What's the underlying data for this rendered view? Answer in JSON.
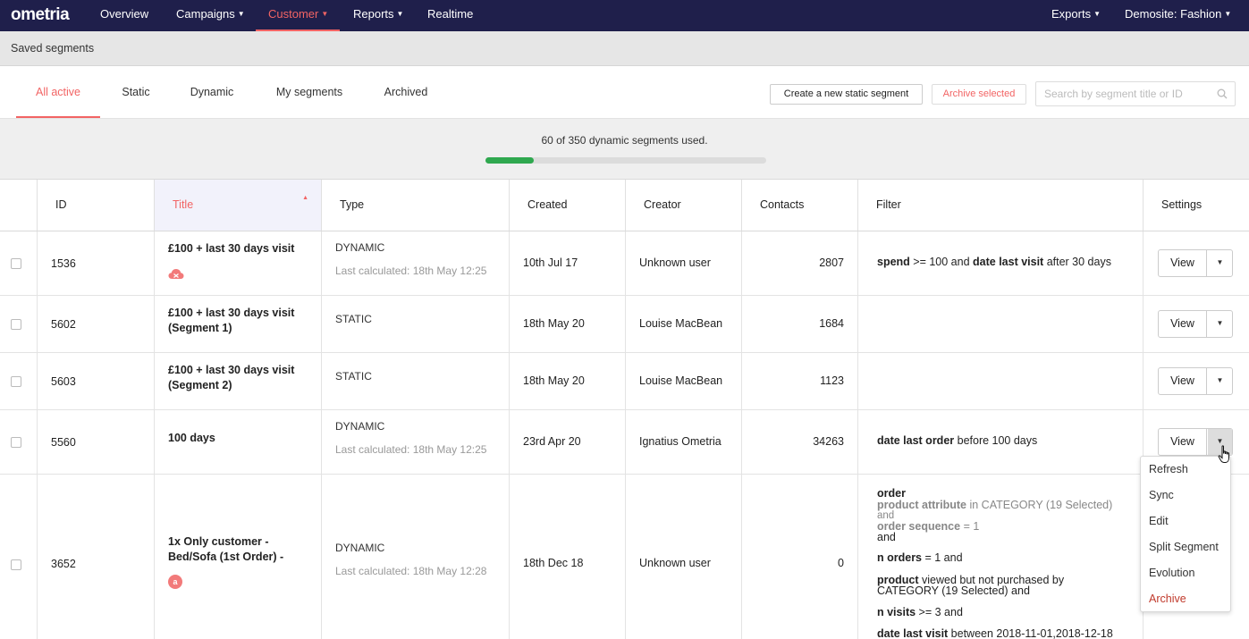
{
  "brand": {
    "logo": "ometria",
    "accent": "#f26464",
    "nav_bg": "#1f1f4b",
    "progress_color": "#2fa84f"
  },
  "nav": {
    "items": [
      {
        "label": "Overview",
        "has_caret": false,
        "active": false
      },
      {
        "label": "Campaigns",
        "has_caret": true,
        "active": false
      },
      {
        "label": "Customer",
        "has_caret": true,
        "active": true
      },
      {
        "label": "Reports",
        "has_caret": true,
        "active": false
      },
      {
        "label": "Realtime",
        "has_caret": false,
        "active": false
      }
    ],
    "right_items": [
      {
        "label": "Exports",
        "has_caret": true
      },
      {
        "label": "Demosite: Fashion",
        "has_caret": true
      }
    ]
  },
  "breadcrumb": "Saved segments",
  "tabs": [
    {
      "label": "All active",
      "active": true
    },
    {
      "label": "Static",
      "active": false
    },
    {
      "label": "Dynamic",
      "active": false
    },
    {
      "label": "My segments",
      "active": false
    },
    {
      "label": "Archived",
      "active": false
    }
  ],
  "actions": {
    "create_label": "Create a new static segment",
    "archive_label": "Archive selected",
    "search_placeholder": "Search by segment title or ID"
  },
  "usage": {
    "text": "60 of 350 dynamic segments used.",
    "used": 60,
    "total": 350
  },
  "columns": [
    "ID",
    "Title",
    "Type",
    "Created",
    "Creator",
    "Contacts",
    "Filter",
    "Settings"
  ],
  "sorted_column": "Title",
  "rows": [
    {
      "id": "1536",
      "title": "£100 + last 30 days visit",
      "type": "DYNAMIC",
      "last_calculated": "Last calculated: 18th May 12:25",
      "created": "10th Jul 17",
      "creator": "Unknown user",
      "contacts": "2807",
      "filter_parts": [
        {
          "b": "spend",
          "t": " >= 100  and  "
        },
        {
          "b": "date last visit",
          "t": " after 30 days"
        }
      ],
      "badge": "cloud-icon"
    },
    {
      "id": "5602",
      "title": "£100 + last 30 days visit (Segment 1)",
      "type": "STATIC",
      "last_calculated": "",
      "created": "18th May 20",
      "creator": "Louise MacBean",
      "contacts": "1684",
      "filter_parts": []
    },
    {
      "id": "5603",
      "title": "£100 + last 30 days visit (Segment 2)",
      "type": "STATIC",
      "last_calculated": "",
      "created": "18th May 20",
      "creator": "Louise MacBean",
      "contacts": "1123",
      "filter_parts": []
    },
    {
      "id": "5560",
      "title": "100 days",
      "type": "DYNAMIC",
      "last_calculated": "Last calculated: 18th May 12:25",
      "created": "23rd Apr 20",
      "creator": "Ignatius Ometria",
      "contacts": "34263",
      "filter_parts": [
        {
          "b": "date last order",
          "t": " before 100 days"
        }
      ]
    },
    {
      "id": "3652",
      "title": "1x Only customer - Bed/Sofa (1st Order) -",
      "type": "DYNAMIC",
      "last_calculated": "Last calculated: 18th May 12:28",
      "created": "18th Dec 18",
      "creator": "Unknown user",
      "contacts": "0",
      "badge": "a-badge-icon",
      "badge_text": "a",
      "filter_lines": [
        {
          "b": "order",
          "t": ""
        },
        {
          "b": "product attribute",
          "t": " in CATEGORY (19 Selected)",
          "grey": true
        },
        {
          "b": "",
          "t": "   and",
          "grey": true
        },
        {
          "b": "order sequence",
          "t": " = 1",
          "grey": true
        },
        {
          "b": "",
          "t": "  and"
        },
        {
          "b": "n orders",
          "t": " = 1  and"
        },
        {
          "b": "product",
          "t": " viewed but not purchased by"
        },
        {
          "b": "",
          "t": "CATEGORY (19 Selected)  and"
        },
        {
          "b": "n visits",
          "t": " >= 3  and"
        },
        {
          "b": "date last visit",
          "t": " between 2018-11-01,2018-12-18"
        }
      ]
    }
  ],
  "view_label": "View",
  "settings_menu": {
    "items": [
      "Refresh",
      "Sync",
      "Edit",
      "Split Segment",
      "Evolution",
      "Archive"
    ]
  }
}
